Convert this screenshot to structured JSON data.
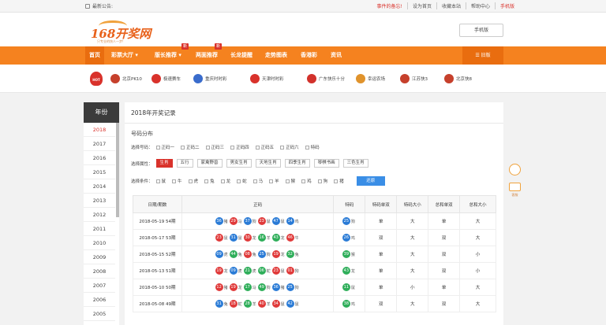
{
  "topbar": {
    "notice": "最新公告:",
    "links": [
      {
        "label": "事件的备忘!",
        "red": true
      },
      {
        "label": "设为首页",
        "red": false
      },
      {
        "label": "收藏本站",
        "red": false
      },
      {
        "label": "帮助中心",
        "red": false
      },
      {
        "label": "手机版",
        "red": true
      }
    ]
  },
  "header": {
    "logo_text": "168开奖网",
    "slogan": "只专业的快人一步!",
    "mobile_button": "手机版"
  },
  "nav": {
    "items": [
      "首页",
      "彩票大厅",
      "版长推荐",
      "两面推荐",
      "长龙提醒",
      "走势图表",
      "香港彩",
      "资讯"
    ],
    "badges": [
      "新",
      "新"
    ],
    "old_version": "旧版"
  },
  "lotteries": [
    {
      "name": "北京PK10",
      "color": "#c6402c"
    },
    {
      "name": "极速赛车",
      "color": "#d9322b"
    },
    {
      "name": "重庆时时彩",
      "color": "#3a6ccc"
    },
    {
      "name": "天津时时彩",
      "color": "#d9322b"
    },
    {
      "name": "广东快乐十分",
      "color": "#d2312b"
    },
    {
      "name": "幸运农场",
      "color": "#e0932c"
    },
    {
      "name": "江苏快3",
      "color": "#c6402c"
    },
    {
      "name": "北京快8",
      "color": "#c6402c"
    }
  ],
  "hot_label": "HOT",
  "sidebar": {
    "title": "年份",
    "years": [
      "2018",
      "2017",
      "2016",
      "2015",
      "2014",
      "2013",
      "2012",
      "2011",
      "2010",
      "2009",
      "2008",
      "2007",
      "2006",
      "2005"
    ],
    "active": "2018"
  },
  "main": {
    "title": "2018年开奖记录",
    "subtitle": "号码分布",
    "filter_number": {
      "label": "选择号码：",
      "options": [
        "正码一",
        "正码二",
        "正码三",
        "正码四",
        "正码五",
        "正码六",
        "特码"
      ]
    },
    "filter_attr": {
      "label": "选择属性：",
      "options": [
        "生肖",
        "五行",
        "家禽野兽",
        "男女生肖",
        "天地生肖",
        "四季生肖",
        "琴棋书画",
        "三色生肖"
      ],
      "active": "生肖"
    },
    "filter_cond": {
      "label": "选择条件：",
      "options": [
        "鼠",
        "牛",
        "虎",
        "兔",
        "龙",
        "蛇",
        "马",
        "羊",
        "猴",
        "鸡",
        "狗",
        "猪"
      ],
      "clear": "还原"
    },
    "table": {
      "headers": [
        "日期/期数",
        "正码",
        "特码",
        "特码单双",
        "特码大小",
        "总和单双",
        "总和大小"
      ],
      "rows": [
        {
          "date": "2018-05-19 54期",
          "balls": [
            [
              "36",
              "猪",
              "blue"
            ],
            [
              "29",
              "马",
              "red"
            ],
            [
              "37",
              "狗",
              "blue"
            ],
            [
              "23",
              "鼠",
              "red"
            ],
            [
              "47",
              "鼠",
              "blue"
            ],
            [
              "14",
              "鸡",
              "blue"
            ]
          ],
          "special": [
            "25",
            "狗",
            "blue"
          ],
          "c1": "单",
          "c2": "大",
          "c3": "单",
          "c4": "大"
        },
        {
          "date": "2018-05-17 53期",
          "balls": [
            [
              "23",
              "鼠",
              "red"
            ],
            [
              "31",
              "鼠",
              "blue"
            ],
            [
              "30",
              "龙",
              "red"
            ],
            [
              "16",
              "羊",
              "green"
            ],
            [
              "43",
              "龙",
              "green"
            ],
            [
              "46",
              "牛",
              "red"
            ]
          ],
          "special": [
            "26",
            "鸡",
            "blue"
          ],
          "c1": "双",
          "c2": "大",
          "c3": "双",
          "c4": "大"
        },
        {
          "date": "2018-05-15 52期",
          "balls": [
            [
              "09",
              "虎",
              "blue"
            ],
            [
              "44",
              "兔",
              "green"
            ],
            [
              "08",
              "兔",
              "red"
            ],
            [
              "25",
              "狗",
              "blue"
            ],
            [
              "19",
              "龙",
              "red"
            ],
            [
              "32",
              "兔",
              "green"
            ]
          ],
          "special": [
            "39",
            "猴",
            "green"
          ],
          "c1": "单",
          "c2": "大",
          "c3": "双",
          "c4": "小"
        },
        {
          "date": "2018-05-13 51期",
          "balls": [
            [
              "19",
              "龙",
              "red"
            ],
            [
              "09",
              "虎",
              "blue"
            ],
            [
              "21",
              "虎",
              "green"
            ],
            [
              "06",
              "蛇",
              "green"
            ],
            [
              "23",
              "鼠",
              "red"
            ],
            [
              "01",
              "狗",
              "red"
            ]
          ],
          "special": [
            "43",
            "龙",
            "green"
          ],
          "c1": "单",
          "c2": "大",
          "c3": "双",
          "c4": "小"
        },
        {
          "date": "2018-05-10 50期",
          "balls": [
            [
              "12",
              "猪",
              "red"
            ],
            [
              "19",
              "龙",
              "red"
            ],
            [
              "17",
              "马",
              "green"
            ],
            [
              "49",
              "狗",
              "green"
            ],
            [
              "36",
              "猪",
              "blue"
            ],
            [
              "25",
              "狗",
              "blue"
            ]
          ],
          "special": [
            "11",
            "鼠",
            "green"
          ],
          "c1": "单",
          "c2": "小",
          "c3": "单",
          "c4": "大"
        },
        {
          "date": "2018-05-08 49期",
          "balls": [
            [
              "31",
              "兔",
              "blue"
            ],
            [
              "18",
              "蛇",
              "red"
            ],
            [
              "28",
              "羊",
              "green"
            ],
            [
              "40",
              "羊",
              "red"
            ],
            [
              "34",
              "鼠",
              "red"
            ],
            [
              "42",
              "鼠",
              "blue"
            ]
          ],
          "special": [
            "38",
            "鸡",
            "green"
          ],
          "c1": "双",
          "c2": "大",
          "c3": "双",
          "c4": "大"
        }
      ]
    }
  },
  "float": {
    "label": "客服"
  }
}
